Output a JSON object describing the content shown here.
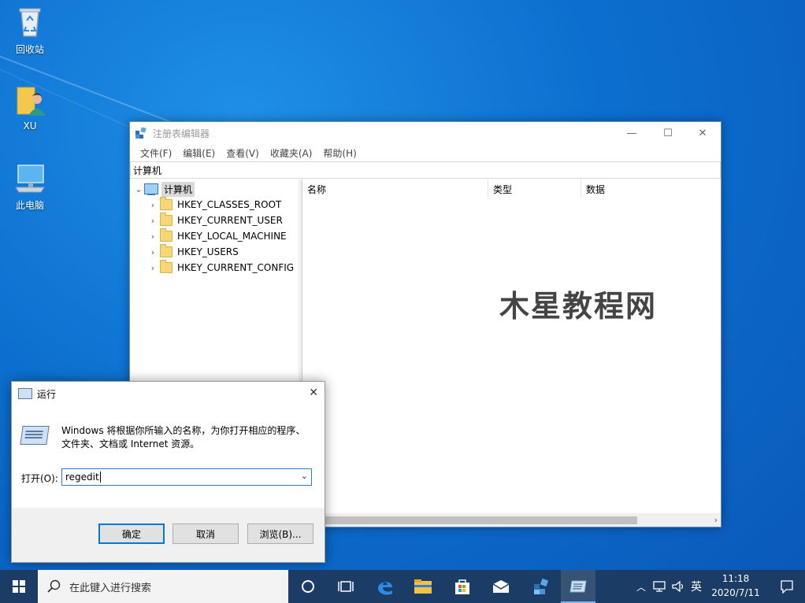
{
  "desktop": {
    "icons": [
      {
        "label": "回收站"
      },
      {
        "label": "XU"
      },
      {
        "label": "此电脑"
      }
    ]
  },
  "regedit": {
    "title": "注册表编辑器",
    "controls": {
      "minimize": "—",
      "maximize": "☐",
      "close": "✕"
    },
    "menu": [
      "文件(F)",
      "编辑(E)",
      "查看(V)",
      "收藏夹(A)",
      "帮助(H)"
    ],
    "address": "计算机",
    "tree_root": "计算机",
    "tree_items": [
      "HKEY_CLASSES_ROOT",
      "HKEY_CURRENT_USER",
      "HKEY_LOCAL_MACHINE",
      "HKEY_USERS",
      "HKEY_CURRENT_CONFIG"
    ],
    "columns": {
      "name": "名称",
      "type": "类型",
      "data": "数据"
    },
    "watermark": "木星教程网"
  },
  "run": {
    "title": "运行",
    "close": "✕",
    "description": "Windows 将根据你所输入的名称，为你打开相应的程序、文件夹、文档或 Internet 资源。",
    "open_label": "打开(O):",
    "input_value": "regedit",
    "buttons": {
      "ok": "确定",
      "cancel": "取消",
      "browse": "浏览(B)..."
    }
  },
  "taskbar": {
    "search_placeholder": "在此键入进行搜索",
    "tray_lang": "英",
    "time": "11:18",
    "date": "2020/7/11"
  }
}
